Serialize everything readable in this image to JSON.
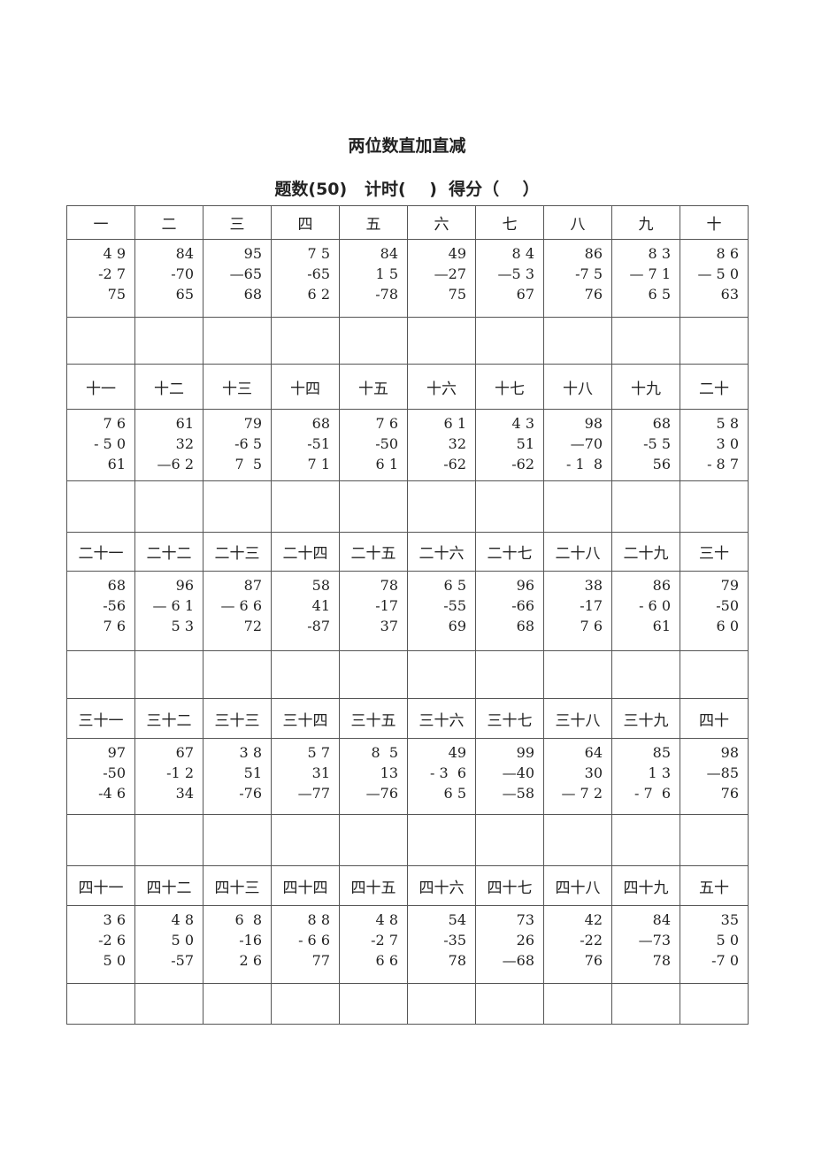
{
  "title": "两位数直加直减",
  "subtitle": "题数(50)   计时(    )  得分（    ）",
  "blocks": [
    {
      "labels": [
        "一",
        "二",
        "三",
        "四",
        "五",
        "六",
        "七",
        "八",
        "九",
        "十"
      ],
      "problems": [
        [
          "4 9",
          "-2 7",
          "75"
        ],
        [
          "84",
          "-70",
          "65"
        ],
        [
          "95",
          "—65",
          "68"
        ],
        [
          "7 5",
          "-65",
          "6 2"
        ],
        [
          "84",
          "1 5",
          "-78"
        ],
        [
          "49",
          "—27",
          "75"
        ],
        [
          "8 4",
          "—5 3",
          "67"
        ],
        [
          "86",
          "-7 5",
          "76"
        ],
        [
          "8 3",
          "— 7 1",
          "6 5"
        ],
        [
          "8 6",
          "— 5 0",
          "63"
        ]
      ]
    },
    {
      "labels": [
        "十一",
        "十二",
        "十三",
        "十四",
        "十五",
        "十六",
        "十七",
        "十八",
        "十九",
        "二十"
      ],
      "problems": [
        [
          "7 6",
          "- 5 0",
          "61"
        ],
        [
          "61",
          "32",
          "—6 2"
        ],
        [
          "79",
          "-6 5",
          "7  5"
        ],
        [
          "68",
          "-51",
          "7 1"
        ],
        [
          "7 6",
          "-50",
          "6 1"
        ],
        [
          "6 1",
          "32",
          "-62"
        ],
        [
          "4 3",
          "51",
          "-62"
        ],
        [
          "98",
          "—70",
          "- 1  8"
        ],
        [
          "68",
          "-5 5",
          "56"
        ],
        [
          "5 8",
          "3 0",
          "- 8 7"
        ]
      ]
    },
    {
      "labels": [
        "二十一",
        "二十二",
        "二十三",
        "二十四",
        "二十五",
        "二十六",
        "二十七",
        "二十八",
        "二十九",
        "三十"
      ],
      "problems": [
        [
          "68",
          "-56",
          "7 6"
        ],
        [
          "96",
          "— 6 1",
          "5 3"
        ],
        [
          "87",
          "— 6 6",
          "72"
        ],
        [
          "58",
          "41",
          "-87"
        ],
        [
          "78",
          "-17",
          "37"
        ],
        [
          "6 5",
          "-55",
          "69"
        ],
        [
          "96",
          "-66",
          "68"
        ],
        [
          "38",
          "-17",
          "7 6"
        ],
        [
          "86",
          "- 6 0",
          "61"
        ],
        [
          "79",
          "-50",
          "6 0"
        ]
      ]
    },
    {
      "labels": [
        "三十一",
        "三十二",
        "三十三",
        "三十四",
        "三十五",
        "三十六",
        "三十七",
        "三十八",
        "三十九",
        "四十"
      ],
      "problems": [
        [
          "97",
          "-50",
          "-4 6"
        ],
        [
          "67",
          "-1 2",
          "34"
        ],
        [
          "3 8",
          "51",
          "-76"
        ],
        [
          "5 7",
          "31",
          "—77"
        ],
        [
          "8  5",
          "13",
          "—76"
        ],
        [
          "49",
          "- 3  6",
          "6 5"
        ],
        [
          "99",
          "—40",
          "—58"
        ],
        [
          "64",
          "30",
          "— 7 2"
        ],
        [
          "85",
          "1 3",
          "- 7  6"
        ],
        [
          "98",
          "—85",
          "76"
        ]
      ]
    },
    {
      "labels": [
        "四十一",
        "四十二",
        "四十三",
        "四十四",
        "四十五",
        "四十六",
        "四十七",
        "四十八",
        "四十九",
        "五十"
      ],
      "problems": [
        [
          "3 6",
          "-2 6",
          "5 0"
        ],
        [
          "4 8",
          "5 0",
          "-57"
        ],
        [
          "6  8",
          "-16",
          "2 6"
        ],
        [
          "8 8",
          "- 6 6",
          "77"
        ],
        [
          "4 8",
          "-2 7",
          "6 6"
        ],
        [
          "54",
          "-35",
          "78"
        ],
        [
          "73",
          "26",
          "—68"
        ],
        [
          "42",
          "-22",
          "76"
        ],
        [
          "84",
          "—73",
          "78"
        ],
        [
          "35",
          "5 0",
          "-7 0"
        ]
      ]
    }
  ]
}
